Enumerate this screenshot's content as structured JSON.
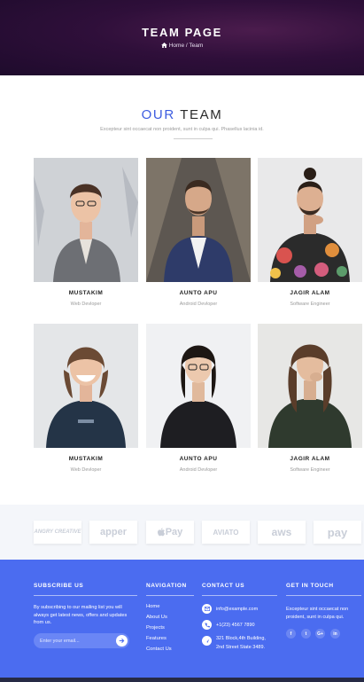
{
  "hero": {
    "title": "TEAM PAGE",
    "breadcrumb": "Home / Team"
  },
  "team_section": {
    "title_accent": "OUR",
    "title_rest": "TEAM",
    "subtitle": "Excepteur sint occaecat non proident, sunt in culpa qui. Phasellus lacinia id."
  },
  "members": [
    {
      "name": "MUSTAKIM",
      "role": "Web Devloper"
    },
    {
      "name": "AUNTO APU",
      "role": "Android Devloper"
    },
    {
      "name": "JAGIR ALAM",
      "role": "Software Engineer"
    },
    {
      "name": "MUSTAKIM",
      "role": "Web Devloper"
    },
    {
      "name": "AUNTO APU",
      "role": "Android Devloper"
    },
    {
      "name": "JAGIR ALAM",
      "role": "Software Engineer"
    }
  ],
  "brands": [
    "ANGRY CREATIVE",
    "apper",
    "Pay",
    "AVIATO",
    "aws",
    "pay"
  ],
  "footer": {
    "subscribe": {
      "title": "SUBSCRIBE US",
      "text": "By subscribing to our mailing list you will always get latest news, offers and updates from us.",
      "placeholder": "Enter your email..."
    },
    "navigation": {
      "title": "NAVIGATION",
      "links": [
        "Home",
        "About Us",
        "Projects",
        "Features",
        "Contact Us"
      ]
    },
    "contact": {
      "title": "CONTACT US",
      "email": "info@example.com",
      "phone": "+1(23) 4567 7890",
      "address_line1": "321 Block,4th Building,",
      "address_line2": "2nd Street State 3489."
    },
    "touch": {
      "title": "GET IN TOUCH",
      "text": "Excepteur sint occaecat non proident, sunt in culpa qui.",
      "socials": [
        "f",
        "t",
        "G+",
        "in"
      ]
    }
  },
  "colors": {
    "accent": "#3c5ce0",
    "footer": "#4b6cf0",
    "hero": "#2f0f3a"
  }
}
